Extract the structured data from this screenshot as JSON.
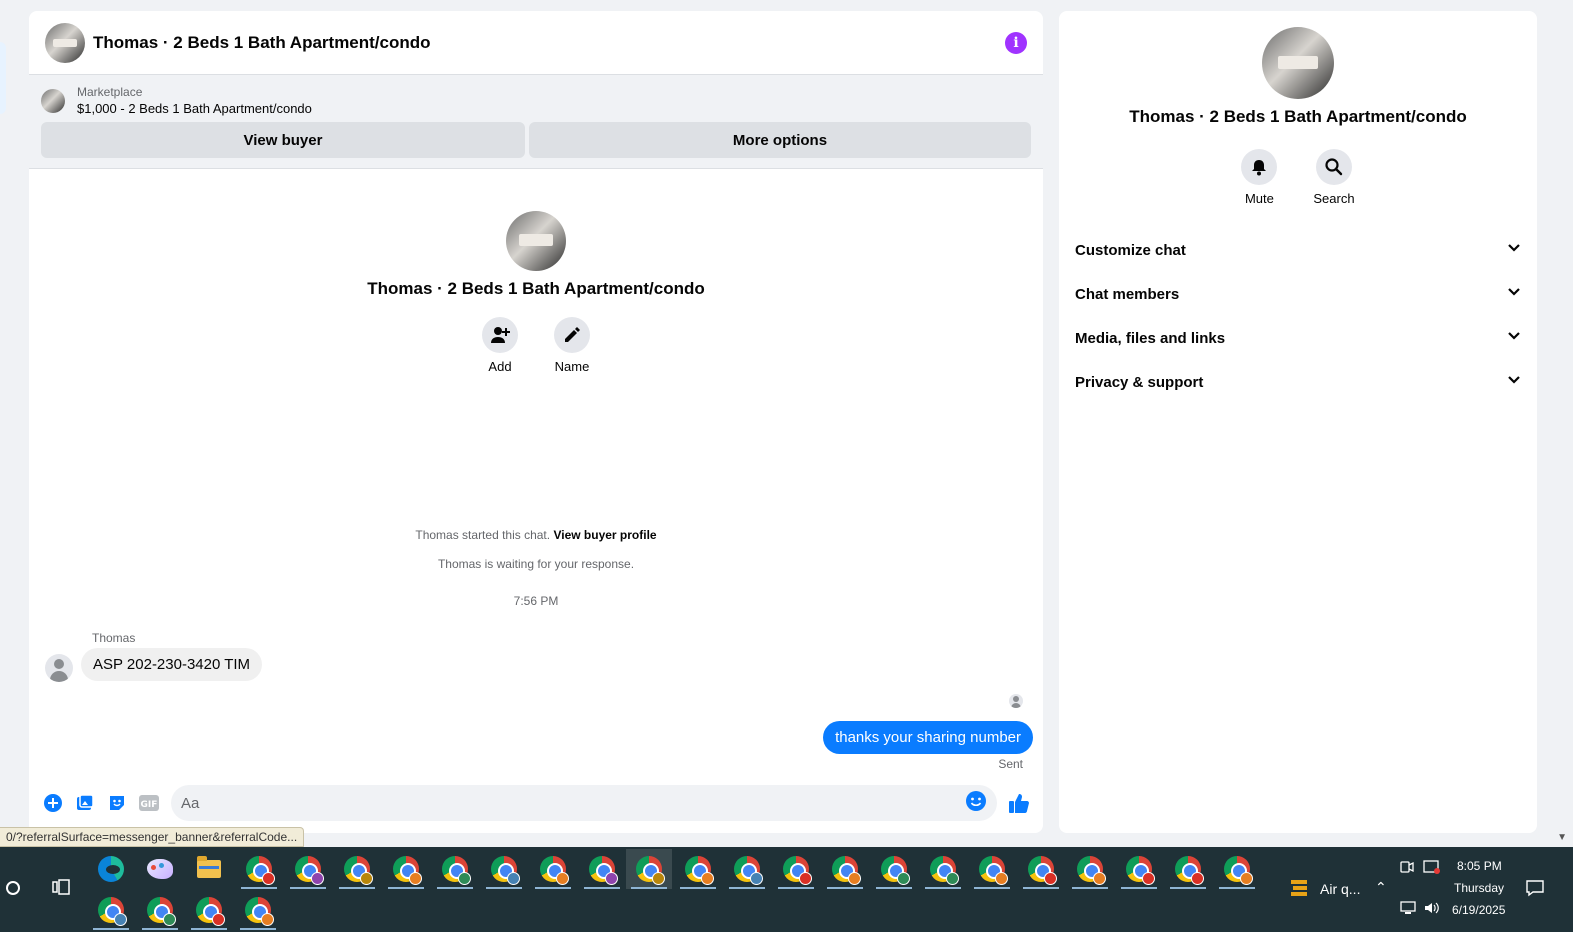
{
  "chat": {
    "title": "Thomas · 2 Beds 1 Bath Apartment/condo",
    "marketplace_label": "Marketplace",
    "listing": "$1,000 - 2 Beds 1 Bath Apartment/condo",
    "view_buyer_label": "View buyer",
    "more_options_label": "More options",
    "intro_title": "Thomas · 2 Beds 1 Bath Apartment/condo",
    "add_label": "Add",
    "name_label": "Name",
    "started_text": "Thomas started this chat.",
    "view_buyer_profile": "View buyer profile",
    "waiting_text": "Thomas is waiting for your response.",
    "timestamp": "7:56 PM",
    "messages": [
      {
        "sender": "Thomas",
        "text": "ASP 202-230-3420 TIM",
        "direction": "in"
      },
      {
        "text": "thanks your sharing number",
        "direction": "out",
        "status": "Sent"
      }
    ],
    "input_placeholder": "Aa"
  },
  "side": {
    "title": "Thomas · 2 Beds 1 Bath Apartment/condo",
    "mute_label": "Mute",
    "search_label": "Search",
    "sections": [
      "Customize chat",
      "Chat members",
      "Media, files and links",
      "Privacy & support"
    ]
  },
  "status_url": "0/?referralSurface=messenger_banner&referralCode...",
  "taskbar": {
    "weather": "Air q...",
    "time": "8:05 PM",
    "day": "Thursday",
    "date": "6/19/2025",
    "badge_colors": [
      "#d93025",
      "#8e44ad",
      "#b8860b",
      "#e67e22",
      "#2e8b57",
      "#4682b4",
      "#e67e22",
      "#8e44ad",
      "#b8860b",
      "#e67e22",
      "#4682b4",
      "#d93025",
      "#e67e22",
      "#2e8b57",
      "#2e8b57",
      "#e67e22",
      "#d93025",
      "#e67e22",
      "#d93025",
      "#d93025",
      "#e67e22",
      "#4682b4",
      "#2e8b57",
      "#d93025",
      "#e67e22"
    ]
  },
  "colors": {
    "accent": "#0a7cff",
    "info": "#a033ff",
    "taskbar": "#1f3137"
  }
}
